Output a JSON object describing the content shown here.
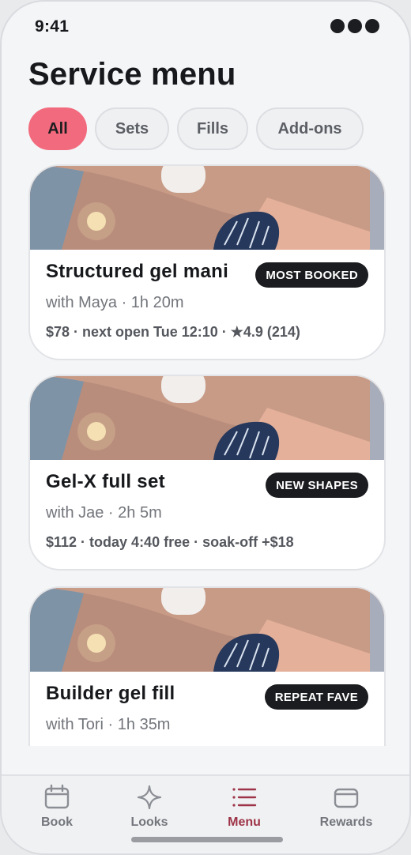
{
  "status": {
    "time": "9:41"
  },
  "page_title": "Service menu",
  "filters": [
    {
      "label": "All",
      "active": true
    },
    {
      "label": "Sets",
      "active": false
    },
    {
      "label": "Fills",
      "active": false
    },
    {
      "label": "Add-ons",
      "active": false
    }
  ],
  "services": [
    {
      "title": "Structured gel mani",
      "badge": "MOST BOOKED",
      "subtitle": "with Maya · 1h 20m",
      "meta": "$78 · next open Tue 12:10 · ★4.9 (214)"
    },
    {
      "title": "Gel-X full set",
      "badge": "NEW SHAPES",
      "subtitle": "with Jae · 2h 5m",
      "meta": "$112 · today 4:40 free · soak-off +$18"
    },
    {
      "title": "Builder gel fill",
      "badge": "REPEAT FAVE",
      "subtitle": "with Tori · 1h 35m",
      "meta": ""
    }
  ],
  "tabs": [
    {
      "label": "Book",
      "icon": "calendar-icon",
      "active": false
    },
    {
      "label": "Looks",
      "icon": "sparkle-icon",
      "active": false
    },
    {
      "label": "Menu",
      "icon": "list-icon",
      "active": true
    },
    {
      "label": "Rewards",
      "icon": "wallet-icon",
      "active": false
    }
  ],
  "colors": {
    "accent": "#f26a7d",
    "active_tab": "#9d3447",
    "badge_bg": "#1b1c1f"
  }
}
